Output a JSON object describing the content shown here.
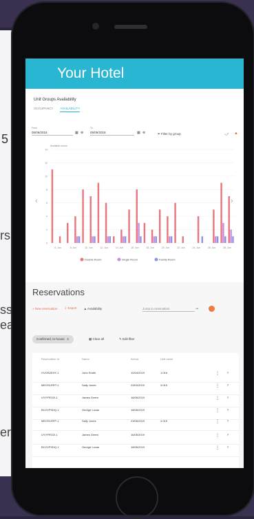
{
  "background": {
    "frag_number": "5",
    "frag_rs": "rs",
    "frag_ss": "ss",
    "frag_ea": "ea",
    "frag_er": "er"
  },
  "header": {
    "title": "Your Hotel"
  },
  "availability": {
    "section_title": "Unit Groups Availability",
    "tabs": [
      "OCCUPANCY",
      "AVAILABILITY"
    ],
    "from_label": "From",
    "from_value": "05/06/2018",
    "to_label": "To",
    "to_value": "05/06/2018",
    "filter_label": "Filter by group"
  },
  "chart_data": {
    "type": "bar",
    "ylabel": "Available rooms",
    "ylim": [
      0,
      14
    ],
    "yticks": [
      0,
      2,
      4,
      6,
      8,
      10,
      12,
      14
    ],
    "categories": [
      "6. Jun",
      "8. Jun",
      "10. Jun",
      "12. Jun",
      "14. Jun",
      "16. Jun",
      "18. Jun",
      "20. Jun",
      "22. Jun",
      "24. Jun",
      "26. Jun",
      "28. Jun"
    ],
    "series": [
      {
        "name": "Double Room",
        "color": "#e8777f",
        "values": [
          11,
          1,
          3,
          4,
          8,
          7,
          9,
          6,
          1,
          2,
          5,
          8,
          3,
          2,
          5,
          4,
          6,
          1,
          0,
          4,
          0,
          5,
          9,
          7
        ]
      },
      {
        "name": "Single Room",
        "color": "#c98fe0",
        "values": [
          0,
          0,
          0,
          1,
          0,
          1,
          0,
          1,
          0,
          1,
          0,
          3,
          0,
          1,
          0,
          1,
          0,
          0,
          0,
          0,
          0,
          1,
          3,
          2
        ]
      },
      {
        "name": "Family Room",
        "color": "#8f93e8",
        "values": [
          0,
          0,
          0,
          1,
          0,
          1,
          0,
          1,
          0,
          1,
          0,
          1,
          0,
          1,
          0,
          1,
          0,
          0,
          0,
          1,
          0,
          1,
          1,
          1
        ]
      }
    ]
  },
  "reservations": {
    "title": "Reservations",
    "new_label": "New reservation",
    "export_label": "Export",
    "availability_label": "Availability",
    "jump_placeholder": "Jump to reservation",
    "chip_label": "Confirmed, In-house",
    "clear_label": "Clear all",
    "edit_label": "Edit filter",
    "columns": [
      "Reservation Id",
      "Name",
      "Arrival",
      "Unit name"
    ],
    "rows": [
      {
        "id": "OVOSZEHY-1",
        "name": "John Smith",
        "arrival": "10/04/2019",
        "unit": "1.016"
      },
      {
        "id": "MEOSLRFP-1",
        "name": "Sally Jones",
        "arrival": "23/04/2019",
        "unit": "4.019"
      },
      {
        "id": "UYYPRO2I-1",
        "name": "James Green",
        "arrival": "16/06/2019",
        "unit": ""
      },
      {
        "id": "BCZVPSDQ-1",
        "name": "George Lucas",
        "arrival": "18/06/2019",
        "unit": ""
      },
      {
        "id": "MEOSLRFP-1",
        "name": "Sally Jones",
        "arrival": "23/06/2019",
        "unit": "4.019"
      },
      {
        "id": "UYYPRO2I-1",
        "name": "James Green",
        "arrival": "16/06/2019",
        "unit": ""
      },
      {
        "id": "BCZVPSDQ-1",
        "name": "George Lucas",
        "arrival": "18/06/2019",
        "unit": ""
      }
    ]
  }
}
